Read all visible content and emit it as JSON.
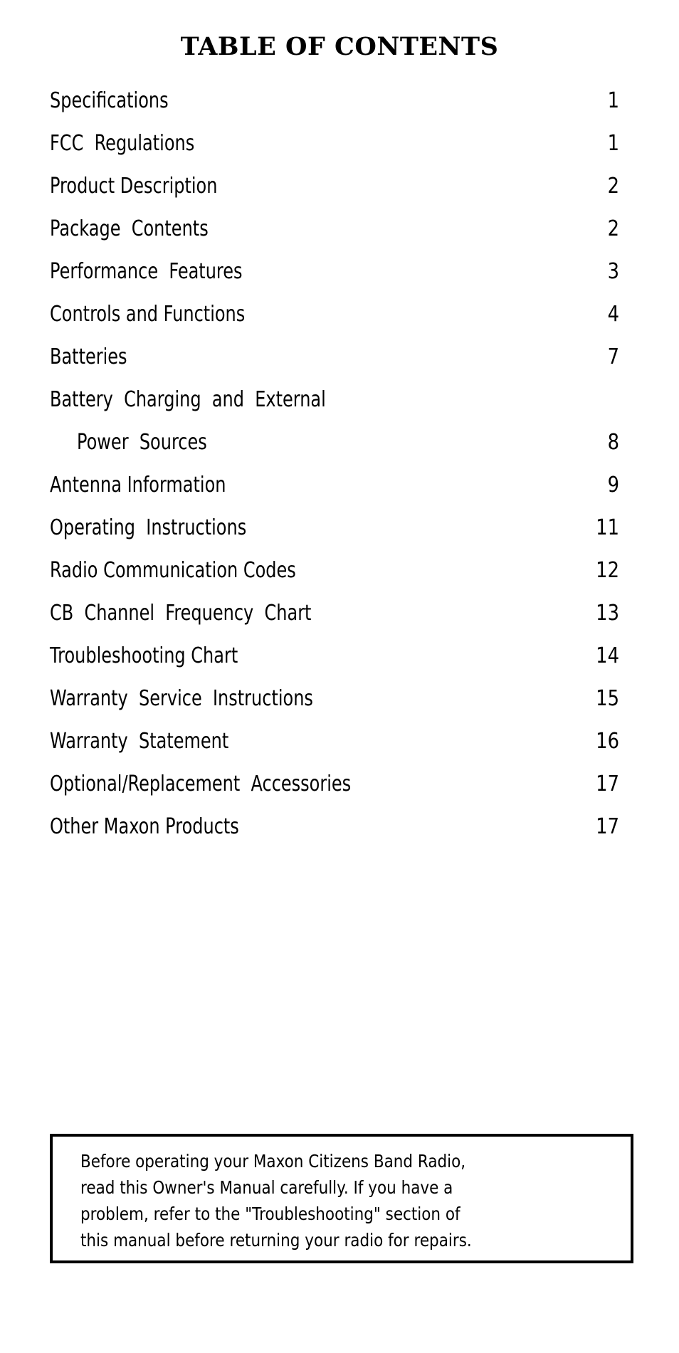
{
  "document": {
    "title": "TABLE OF CONTENTS"
  },
  "toc": {
    "entries": [
      {
        "label": "Specifications",
        "page": "1",
        "indent": false,
        "second_line": null
      },
      {
        "label": "FCC  Regulations",
        "page": "1",
        "indent": false,
        "second_line": null
      },
      {
        "label": "Product Description",
        "page": "2",
        "indent": false,
        "second_line": null
      },
      {
        "label": "Package  Contents",
        "page": "2",
        "indent": false,
        "second_line": null
      },
      {
        "label": "Performance  Features",
        "page": "3",
        "indent": false,
        "second_line": null
      },
      {
        "label": "Controls and Functions",
        "page": "4",
        "indent": false,
        "second_line": null
      },
      {
        "label": "Batteries",
        "page": "7",
        "indent": false,
        "second_line": null
      },
      {
        "label": "Battery  Charging  and  External",
        "page": "8",
        "indent": false,
        "second_line": "Power  Sources"
      },
      {
        "label": "Antenna Information",
        "page": "9",
        "indent": false,
        "second_line": null
      },
      {
        "label": "Operating  Instructions",
        "page": "11",
        "indent": false,
        "second_line": null
      },
      {
        "label": "Radio Communication Codes",
        "page": "12",
        "indent": false,
        "second_line": null
      },
      {
        "label": "CB  Channel  Frequency  Chart",
        "page": "13",
        "indent": false,
        "second_line": null
      },
      {
        "label": "Troubleshooting Chart",
        "page": "14",
        "indent": false,
        "second_line": null
      },
      {
        "label": "Warranty  Service  Instructions",
        "page": "15",
        "indent": false,
        "second_line": null
      },
      {
        "label": "Warranty  Statement",
        "page": "16",
        "indent": false,
        "second_line": null
      },
      {
        "label": "Optional/Replacement  Accessories",
        "page": "17",
        "indent": false,
        "second_line": null
      },
      {
        "label": "Other Maxon Products",
        "page": "17",
        "indent": false,
        "second_line": null
      }
    ]
  },
  "note": {
    "lines": [
      "Before operating your Maxon Citizens Band Radio,",
      "read this Owner's Manual carefully. If you have a",
      "problem, refer to the \"Troubleshooting\" section of",
      "this manual before returning your radio for repairs."
    ]
  },
  "colors": {
    "text": "#000000",
    "background": "#ffffff",
    "box_border": "#000000"
  }
}
